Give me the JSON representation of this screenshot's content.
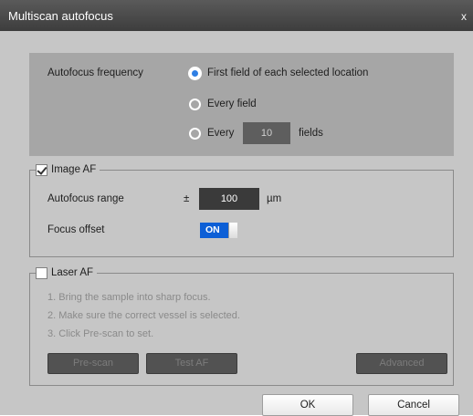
{
  "window": {
    "title": "Multiscan autofocus",
    "close_glyph": "x"
  },
  "frequency": {
    "label": "Autofocus frequency",
    "options": [
      {
        "label": "First field of each selected location",
        "selected": true
      },
      {
        "label": "Every field",
        "selected": false
      },
      {
        "label_prefix": "Every",
        "value": "10",
        "label_suffix": "fields",
        "selected": false
      }
    ]
  },
  "image_af": {
    "label": "Image AF",
    "checked": true,
    "range_label": "Autofocus range",
    "range_prefix": "±",
    "range_value": "100",
    "range_unit": "µm",
    "offset_label": "Focus offset",
    "offset_toggle": "ON"
  },
  "laser_af": {
    "label": "Laser AF",
    "checked": false,
    "steps": [
      "1. Bring the sample into sharp focus.",
      "2. Make sure the correct vessel is selected.",
      "3. Click Pre-scan to set."
    ],
    "buttons": {
      "prescan": "Pre-scan",
      "test_af": "Test AF",
      "advanced": "Advanced"
    }
  },
  "footer": {
    "ok": "OK",
    "cancel": "Cancel"
  },
  "colors": {
    "accent": "#2f7fe4",
    "toggle_on": "#0d5fd6",
    "panel_bg": "#a6a6a6",
    "dialog_bg": "#c6c6c6"
  }
}
